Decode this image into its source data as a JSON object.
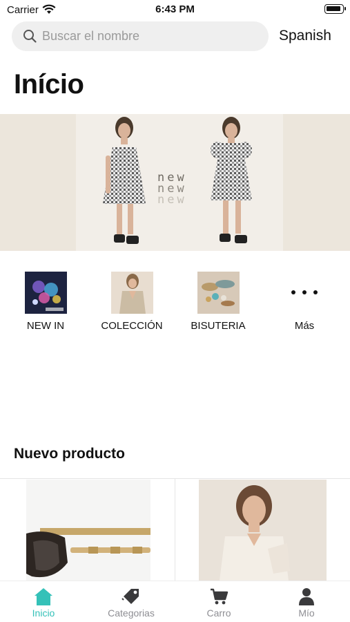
{
  "status_bar": {
    "carrier": "Carrier",
    "time": "6:43 PM"
  },
  "search": {
    "placeholder": "Buscar el nombre",
    "value": ""
  },
  "language_label": "Spanish",
  "page_title": "Início",
  "banner": {
    "lines": [
      "new",
      "new",
      "new"
    ]
  },
  "categories": [
    {
      "label": "NEW IN",
      "image": "new-in-thumbnail"
    },
    {
      "label": "COLECCIÓN",
      "image": "coleccion-thumbnail"
    },
    {
      "label": "BISUTERIA",
      "image": "bisuteria-thumbnail"
    },
    {
      "label": "Más",
      "icon": "more-dots-icon"
    }
  ],
  "section_title": "Nuevo producto",
  "products": [
    {
      "image": "sunglasses-product-image"
    },
    {
      "image": "cream-dress-product-image"
    }
  ],
  "tabs": [
    {
      "label": "Inicio",
      "icon": "home-icon",
      "active": true
    },
    {
      "label": "Categorias",
      "icon": "tag-icon",
      "active": false
    },
    {
      "label": "Carro",
      "icon": "cart-icon",
      "active": false
    },
    {
      "label": "Mío",
      "icon": "person-icon",
      "active": false
    }
  ],
  "colors": {
    "accent": "#34c1b8",
    "inactive": "#8e8e93",
    "search_bg": "#efefef",
    "banner_bg": "#ece6dc"
  }
}
